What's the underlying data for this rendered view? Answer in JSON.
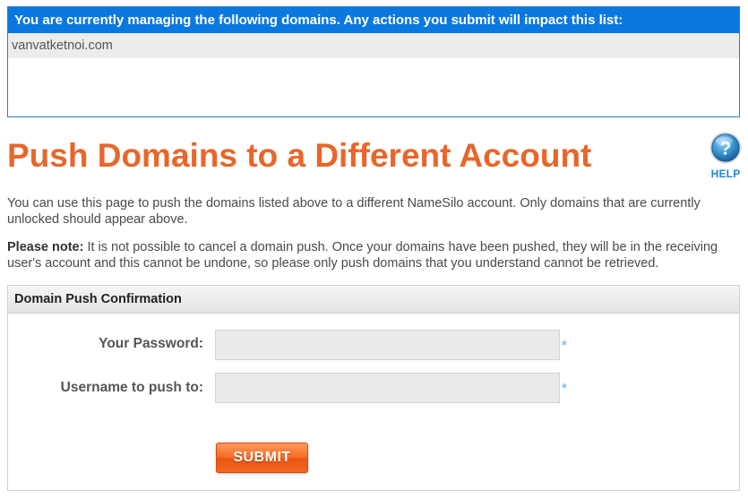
{
  "managed": {
    "header": "You are currently managing the following domains. Any actions you submit will impact this list:",
    "domains": [
      "vanvatketnoi.com"
    ]
  },
  "page": {
    "title": "Push Domains to a Different Account",
    "help_label": "HELP",
    "help_icon_glyph": "?",
    "description": "You can use this page to push the domains listed above to a different NameSilo account. Only domains that are currently unlocked should appear above.",
    "note_label": "Please note:",
    "note_text": " It is not possible to cancel a domain push. Once your domains have been pushed, they will be in the receiving user's account and this cannot be undone, so please only push domains that you understand cannot be retrieved."
  },
  "form": {
    "header": "Domain Push Confirmation",
    "password_label": "Your Password:",
    "password_value": "",
    "username_label": "Username to push to:",
    "username_value": "",
    "required_marker": "*",
    "submit_label": "SUBMIT"
  },
  "colors": {
    "header_blue": "#0a78df",
    "title_orange": "#e8662b",
    "help_blue": "#1f87d6",
    "submit_orange": "#f66d24",
    "required_blue": "#7ec3ec"
  },
  "icons": {
    "help": "help-circle-icon"
  }
}
